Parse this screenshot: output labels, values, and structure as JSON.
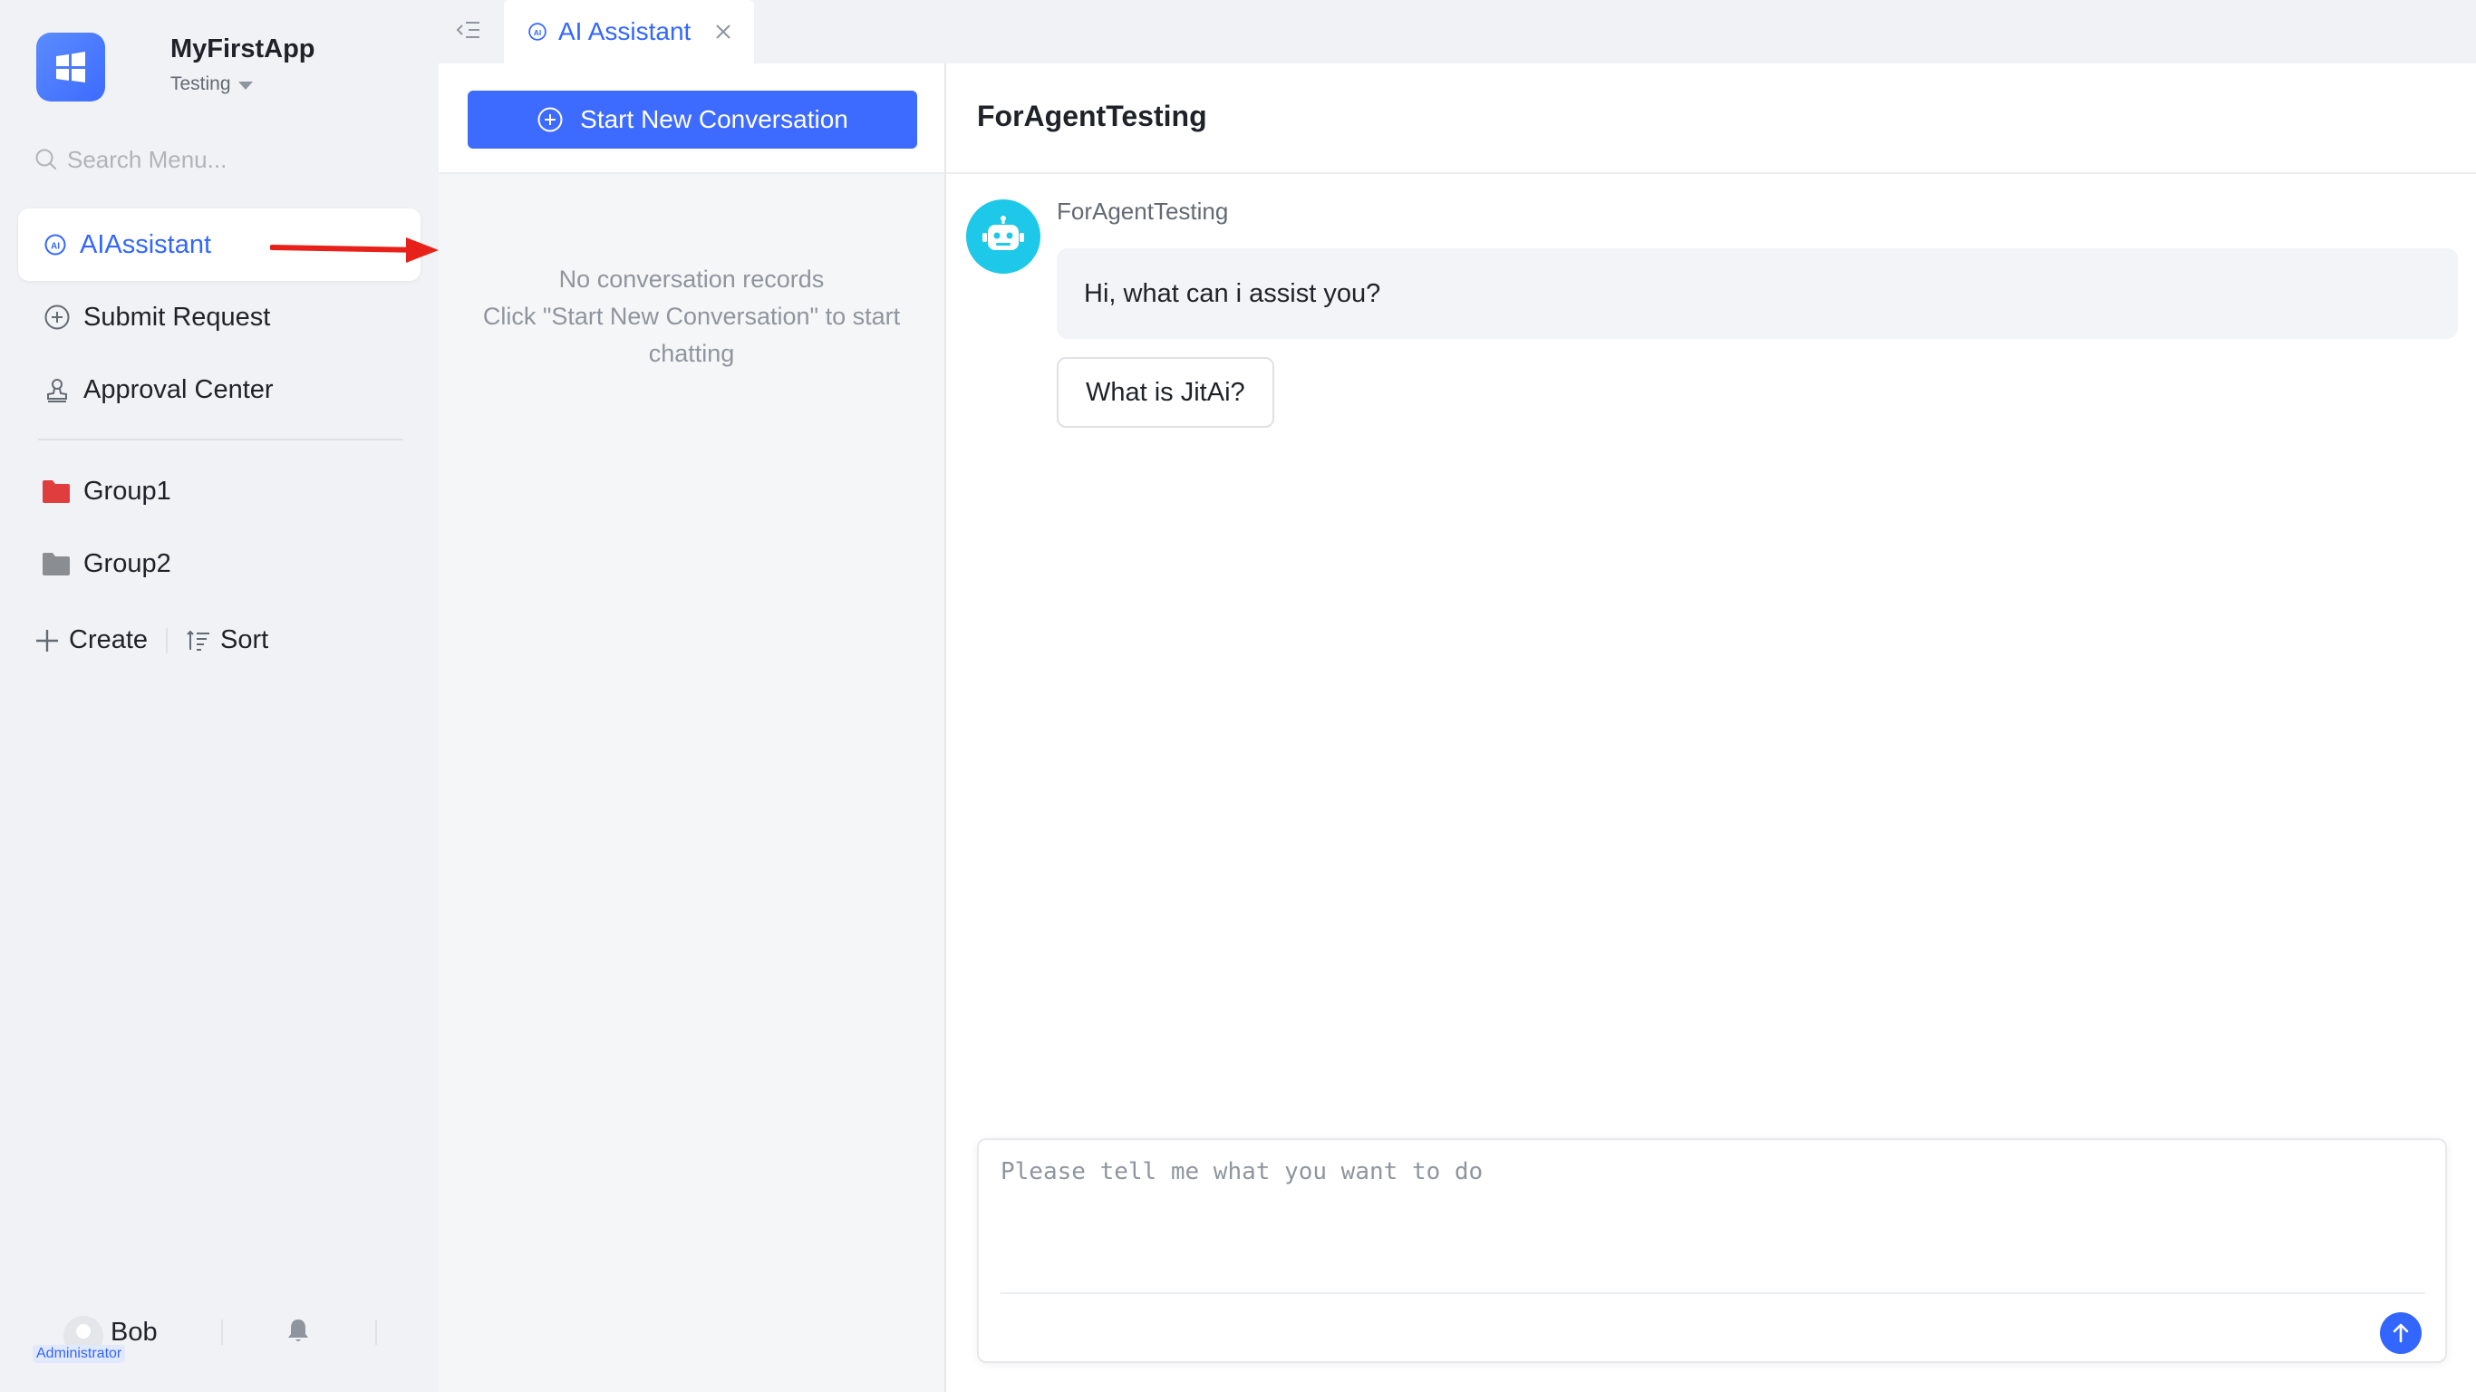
{
  "app": {
    "name": "MyFirstApp",
    "env": "Testing"
  },
  "search": {
    "placeholder": "Search Menu..."
  },
  "menu": {
    "items": [
      {
        "label": "AIAssistant",
        "icon": "ai-icon",
        "active": true
      },
      {
        "label": "Submit Request",
        "icon": "plus-circle-icon",
        "active": false
      },
      {
        "label": "Approval Center",
        "icon": "stamp-icon",
        "active": false
      }
    ],
    "groups": [
      {
        "label": "Group1",
        "icon": "folder-icon",
        "color": "#e03e3e"
      },
      {
        "label": "Group2",
        "icon": "folder-icon",
        "color": "#8a8d91"
      }
    ],
    "create_label": "Create",
    "sort_label": "Sort"
  },
  "user": {
    "name": "Bob",
    "role": "Administrator"
  },
  "tabs": [
    {
      "label": "AI Assistant",
      "icon": "ai-icon"
    }
  ],
  "conversations": {
    "new_button_label": "Start New Conversation",
    "empty_line1": "No conversation records",
    "empty_line2": "Click \"Start New Conversation\" to start chatting"
  },
  "chat": {
    "title": "ForAgentTesting",
    "bot_name": "ForAgentTesting",
    "bot_message": "Hi, what can i assist you?",
    "suggestion": "What is JitAi?",
    "input_placeholder": "Please tell me what you want to do"
  },
  "colors": {
    "accent": "#3366ff",
    "button": "#3e6bff",
    "bot_avatar": "#1ec8e8",
    "annotation_arrow": "#e8201a"
  }
}
